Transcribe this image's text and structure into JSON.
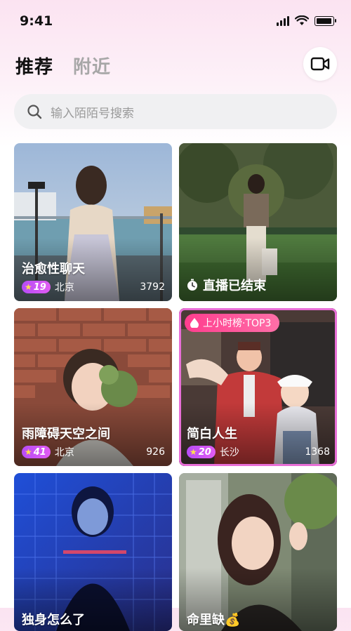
{
  "status_bar": {
    "time": "9:41"
  },
  "header": {
    "tabs": [
      {
        "label": "推荐",
        "active": true
      },
      {
        "label": "附近",
        "active": false
      }
    ],
    "camera_icon": "video-camera-icon"
  },
  "search": {
    "placeholder": "输入陌陌号搜索",
    "icon": "search-icon"
  },
  "cards": [
    {
      "title": "治愈性聊天",
      "level": "19",
      "city": "北京",
      "count": "3792"
    },
    {
      "status": "直播已结束"
    },
    {
      "title": "雨障碍天空之间",
      "level": "41",
      "city": "北京",
      "count": "926"
    },
    {
      "rank": "上小时榜·TOP3",
      "title": "简白人生",
      "level": "20",
      "city": "长沙",
      "count": "1368"
    },
    {
      "title": "独身怎么了"
    },
    {
      "title": "命里缺",
      "title_emoji": "💰"
    }
  ],
  "colors": {
    "accent_pink": "#ff3d8e",
    "badge_purple": "#b64cf6",
    "highlight_border": "#e86fd7"
  }
}
